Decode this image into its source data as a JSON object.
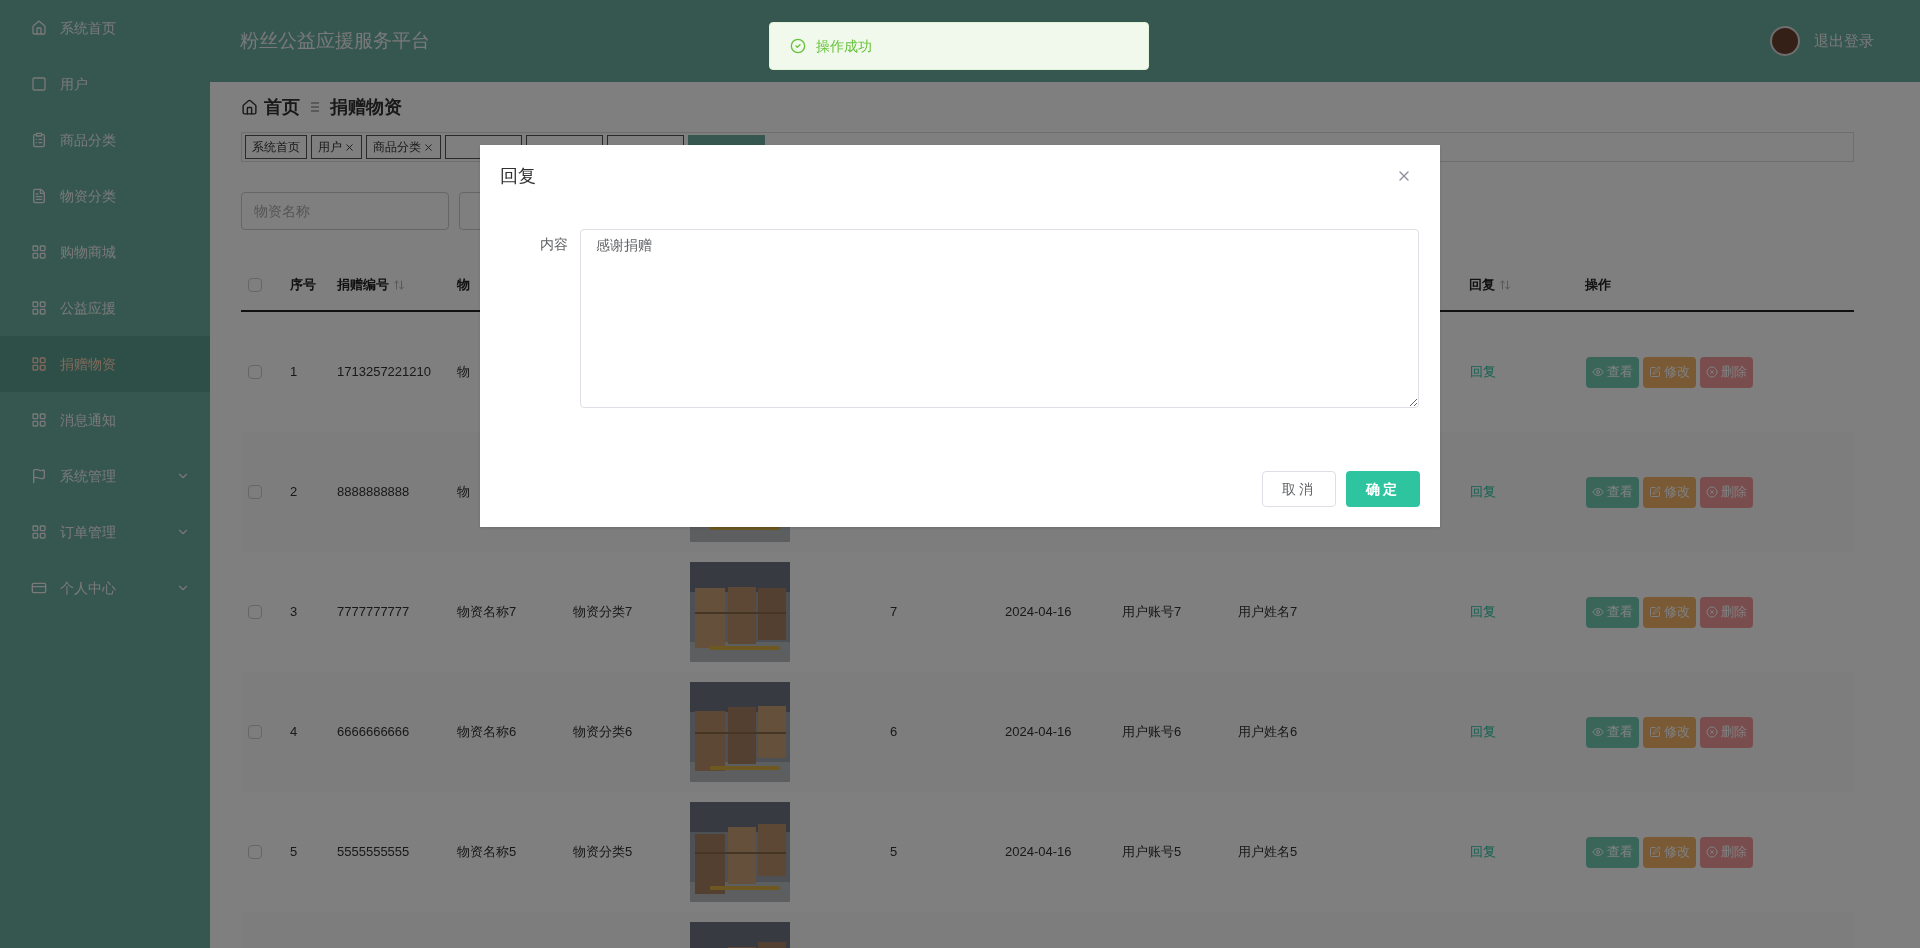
{
  "sidebar": {
    "items": [
      {
        "label": "系统首页",
        "selected": false
      },
      {
        "label": "用户",
        "selected": false
      },
      {
        "label": "商品分类",
        "selected": false
      },
      {
        "label": "物资分类",
        "selected": false
      },
      {
        "label": "购物商城",
        "selected": false
      },
      {
        "label": "公益应援",
        "selected": false
      },
      {
        "label": "捐赠物资",
        "selected": true
      },
      {
        "label": "消息通知",
        "selected": false
      },
      {
        "label": "系统管理",
        "selected": false,
        "expanded": false
      },
      {
        "label": "订单管理",
        "selected": false,
        "expanded": false
      },
      {
        "label": "个人中心",
        "selected": false,
        "expanded": false
      }
    ]
  },
  "header": {
    "title": "粉丝公益应援服务平台",
    "logout": "退出登录"
  },
  "toast": {
    "message": "操作成功"
  },
  "breadcrumb": [
    "首页",
    "捐赠物资"
  ],
  "tags": [
    {
      "label": "系统首页",
      "closable": false,
      "selected": false
    },
    {
      "label": "用户",
      "closable": true,
      "selected": false
    },
    {
      "label": "商品分类",
      "closable": true,
      "selected": false
    },
    {
      "selected": false
    },
    {
      "selected": false
    },
    {
      "selected": false
    },
    {
      "selected": true
    }
  ],
  "search": {
    "placeholder": "物资名称"
  },
  "table": {
    "select_all": {
      "checked": false
    },
    "columns": [
      {
        "label": "序号",
        "sortable": false
      },
      {
        "label": "捐赠编号",
        "sortable": true
      },
      {
        "label": "物",
        "sortable": false
      },
      {
        "label": "回复",
        "sortable": true
      },
      {
        "label": "操作",
        "sortable": false
      }
    ],
    "rows": [
      {
        "checked": false,
        "index": "1",
        "code": "1713257221210",
        "name": "物",
        "picture": false,
        "reply": "回复",
        "actions": [
          "查看",
          "修改",
          "删除"
        ]
      },
      {
        "checked": false,
        "index": "2",
        "code": "8888888888",
        "name": "物",
        "picture": true,
        "reply": "回复",
        "actions": [
          "查看",
          "修改",
          "删除"
        ]
      },
      {
        "checked": false,
        "index": "3",
        "code": "7777777777",
        "name": "物资名称7",
        "category": "物资分类7",
        "picture": true,
        "qty": "7",
        "date": "2024-04-16",
        "account": "用户账号7",
        "user": "用户姓名7",
        "reply": "回复",
        "actions": [
          "查看",
          "修改",
          "删除"
        ]
      },
      {
        "checked": false,
        "index": "4",
        "code": "6666666666",
        "name": "物资名称6",
        "category": "物资分类6",
        "picture": true,
        "qty": "6",
        "date": "2024-04-16",
        "account": "用户账号6",
        "user": "用户姓名6",
        "reply": "回复",
        "actions": [
          "查看",
          "修改",
          "删除"
        ]
      },
      {
        "checked": false,
        "index": "5",
        "code": "5555555555",
        "name": "物资名称5",
        "category": "物资分类5",
        "picture": true,
        "qty": "5",
        "date": "2024-04-16",
        "account": "用户账号5",
        "user": "用户姓名5",
        "reply": "回复",
        "actions": [
          "查看",
          "修改",
          "删除"
        ]
      },
      {
        "picture": true
      }
    ]
  },
  "dialog": {
    "title": "回复",
    "label": "内容",
    "value": "感谢捐赠",
    "buttons": [
      {
        "label": "取消",
        "kind": "secondary"
      },
      {
        "label": "确定",
        "kind": "primary"
      }
    ]
  }
}
